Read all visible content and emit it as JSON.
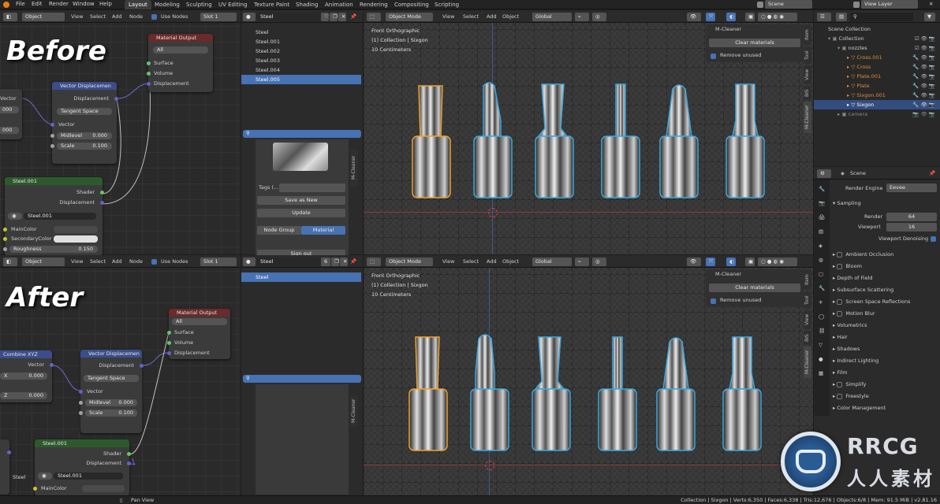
{
  "top_menu": [
    "File",
    "Edit",
    "Render",
    "Window",
    "Help"
  ],
  "workspaces": {
    "tabs": [
      "Layout",
      "Modeling",
      "Sculpting",
      "UV Editing",
      "Texture Paint",
      "Shading",
      "Animation",
      "Rendering",
      "Compositing",
      "Scripting"
    ],
    "active": "Layout"
  },
  "scene_field": "Scene",
  "view_layer_field": "View Layer",
  "labels": {
    "before": "Before",
    "after": "After"
  },
  "node_editor": {
    "header": {
      "mode": "Object",
      "menus": [
        "View",
        "Select",
        "Add",
        "Node"
      ],
      "use_nodes": "Use Nodes",
      "slot": "Slot 1"
    },
    "top": {
      "material_output": {
        "title": "Material Output",
        "target": "All",
        "sockets": [
          "Surface",
          "Volume",
          "Displacement"
        ]
      },
      "vector_displacement": {
        "title": "Vector Displacemen",
        "output": "Displacement",
        "space": "Tangent Space",
        "input": "Vector",
        "midlevel_label": "Midlevel",
        "midlevel": "0.000",
        "scale_label": "Scale",
        "scale": "0.100"
      },
      "left_partial": {
        "label": "Vector",
        "v1": "000",
        "v2": "000"
      },
      "steel_group": {
        "title": "Steel.001",
        "out_shader": "Shader",
        "out_disp": "Displacement",
        "datablock": "Steel.001",
        "main_color": "MainColor",
        "secondary_color": "SecondaryColor",
        "roughness_label": "Roughness",
        "roughness": "0.150"
      }
    },
    "bottom": {
      "material_output": {
        "title": "Material Output",
        "target": "All",
        "sockets": [
          "Surface",
          "Volume",
          "Displacement"
        ]
      },
      "combine_xyz": {
        "title": "Combine XYZ",
        "output": "Vector",
        "x_label": "X",
        "x": "0.000",
        "z_label": "Z",
        "z": "0.000"
      },
      "vector_displacement": {
        "title": "Vector Displacemen",
        "output": "Displacement",
        "space": "Tangent Space",
        "input": "Vector",
        "midlevel_label": "Midlevel",
        "midlevel": "0.000",
        "scale_label": "Scale",
        "scale": "0.100"
      },
      "steel_group": {
        "title": "Steel.001",
        "out_shader": "Shader",
        "out_disp": "Displacement",
        "datablock": "Steel.001",
        "main_color": "MainColor"
      },
      "left_label": "Steel"
    }
  },
  "material_panel": {
    "top": {
      "field": "Steel",
      "list": [
        "Steel",
        "Steel.001",
        "Steel.002",
        "Steel.003",
        "Steel.004",
        "Steel.005"
      ],
      "selected_index": 5,
      "tags_label": "Tags (...",
      "save_as_new": "Save as New",
      "update": "Update",
      "tab_node_group": "Node Group",
      "tab_material": "Material",
      "sign_out": "Sign out",
      "side_tab": "M-Cleaner"
    },
    "bottom": {
      "field": "Steel",
      "users": "6",
      "list": [
        "Steel"
      ],
      "selected_index": 0,
      "side_tab": "M-Cleaner"
    }
  },
  "viewport": {
    "header": {
      "mode": "Object Mode",
      "menus": [
        "View",
        "Select",
        "Add",
        "Object"
      ],
      "orientation": "Global"
    },
    "overlay_top": [
      "Front Orthographic",
      "(1) Collection | Sixgon",
      "10 Centimeters"
    ],
    "overlay_bottom": [
      "Front Orthographic",
      "(1) Collection | Sixgon",
      "10 Centimeters"
    ],
    "npanel": {
      "title": "M-Cleaner",
      "clear_button": "Clear materials",
      "remove_unused": "Remove unused"
    },
    "side_tabs": [
      "Item",
      "Tool",
      "View",
      "BIS",
      "M-Cleaner"
    ],
    "colors": {
      "active_outline": "#f0a030",
      "selected_outline": "#3aa8e0"
    }
  },
  "outliner": {
    "items": [
      {
        "label": "Scene Collection",
        "color": "#d0d0d0",
        "indent": 0
      },
      {
        "label": "Collection",
        "color": "#d0d0d0",
        "indent": 1
      },
      {
        "label": "nozzles",
        "color": "#d0d0d0",
        "indent": 2
      },
      {
        "label": "Cross.001",
        "color": "#e08a3c",
        "indent": 3
      },
      {
        "label": "Cross",
        "color": "#e08a3c",
        "indent": 3
      },
      {
        "label": "Plate.001",
        "color": "#e08a3c",
        "indent": 3
      },
      {
        "label": "Plate",
        "color": "#e08a3c",
        "indent": 3
      },
      {
        "label": "Sixgon.001",
        "color": "#e08a3c",
        "indent": 3
      },
      {
        "label": "Sixgon",
        "color": "#ffffff",
        "indent": 3,
        "selected": true
      },
      {
        "label": "camera",
        "color": "#8a8a8a",
        "indent": 1
      }
    ]
  },
  "properties": {
    "scene": "Scene",
    "render_engine_label": "Render Engine",
    "render_engine": "Eevee",
    "sampling": "Sampling",
    "render_label": "Render",
    "render_samples": "64",
    "viewport_label": "Viewport",
    "viewport_samples": "16",
    "viewport_denoising": "Viewport Denoising",
    "sections": [
      {
        "label": "Ambient Occlusion",
        "checkbox": true
      },
      {
        "label": "Bloom",
        "checkbox": true
      },
      {
        "label": "Depth of Field",
        "checkbox": false
      },
      {
        "label": "Subsurface Scattering",
        "checkbox": false
      },
      {
        "label": "Screen Space Reflections",
        "checkbox": true
      },
      {
        "label": "Motion Blur",
        "checkbox": true
      },
      {
        "label": "Volumetrics",
        "checkbox": false
      },
      {
        "label": "Hair",
        "checkbox": false
      },
      {
        "label": "Shadows",
        "checkbox": false
      },
      {
        "label": "Indirect Lighting",
        "checkbox": false
      },
      {
        "label": "Film",
        "checkbox": false
      },
      {
        "label": "Simplify",
        "checkbox": true
      },
      {
        "label": "Freestyle",
        "checkbox": true
      },
      {
        "label": "Color Management",
        "checkbox": false
      }
    ]
  },
  "status_bar": {
    "left": "Pan View",
    "right": "Collection | Sixgon | Verts:6,350 | Faces:6,338 | Tris:12,676 | Objects:6/8 | Mem: 91.5 MiB | v2.81.16"
  },
  "watermark": {
    "line1": "RRCG",
    "line2": "人人素材"
  }
}
